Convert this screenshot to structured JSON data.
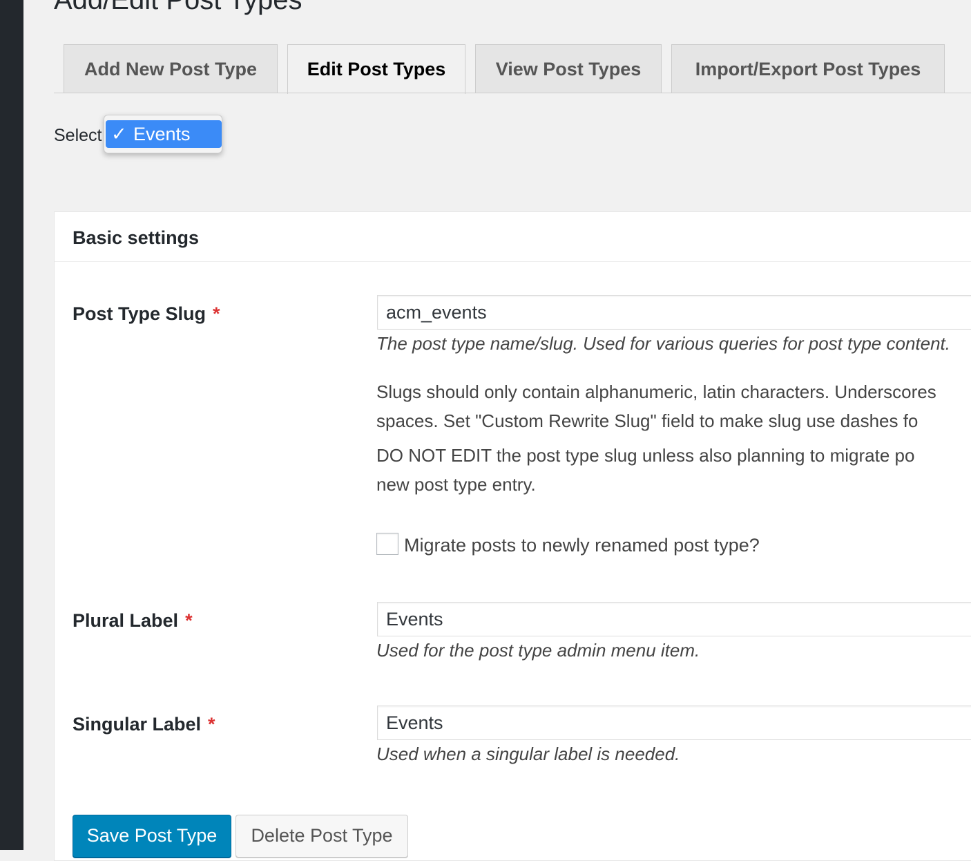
{
  "page": {
    "title": "Add/Edit Post Types"
  },
  "tabs": [
    {
      "label": "Add New Post Type",
      "active": false
    },
    {
      "label": "Edit Post Types",
      "active": true
    },
    {
      "label": "View Post Types",
      "active": false
    },
    {
      "label": "Import/Export Post Types",
      "active": false
    }
  ],
  "selector": {
    "label": "Select",
    "selected_option": "Events",
    "check_glyph": "✓"
  },
  "panel": {
    "title": "Basic settings",
    "required_mark": "*",
    "slug": {
      "label": "Post Type Slug",
      "value": "acm_events",
      "help": "The post type name/slug. Used for various queries for post type content.",
      "note1_line1": "Slugs should only contain alphanumeric, latin characters. Underscores",
      "note1_line2": "spaces. Set \"Custom Rewrite Slug\" field to make slug use dashes fo",
      "note2_line1": "DO NOT EDIT the post type slug unless also planning to migrate po",
      "note2_line2": "new post type entry.",
      "migrate_label": "Migrate posts to newly renamed post type?",
      "migrate_checked": false
    },
    "plural": {
      "label": "Plural Label",
      "value": "Events",
      "help": "Used for the post type admin menu item."
    },
    "singular": {
      "label": "Singular Label",
      "value": "Events",
      "help": "Used when a singular label is needed."
    }
  },
  "buttons": {
    "save": "Save Post Type",
    "delete": "Delete Post Type"
  },
  "colors": {
    "primary_button": "#0085ba",
    "selection_highlight": "#3b8bf7",
    "required": "#dc3232",
    "admin_bar": "#23282d"
  }
}
